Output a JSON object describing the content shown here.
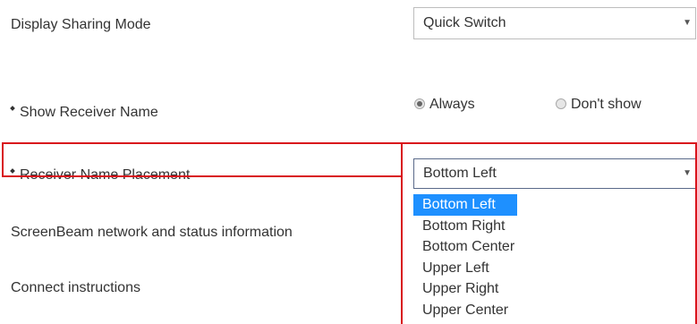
{
  "settings": {
    "display_sharing_mode": {
      "label": "Display Sharing Mode",
      "value": "Quick Switch"
    },
    "show_receiver_name": {
      "label": "Show Receiver Name",
      "options": [
        "Always",
        "Don't show"
      ],
      "selected": "Always"
    },
    "receiver_name_placement": {
      "label": "Receiver Name Placement",
      "value": "Bottom Left",
      "options": [
        "Bottom Left",
        "Bottom Right",
        "Bottom Center",
        "Upper Left",
        "Upper Right",
        "Upper Center"
      ]
    },
    "network_info": {
      "label": "ScreenBeam network and status information"
    },
    "connect_instructions": {
      "label": "Connect instructions"
    }
  },
  "icons": {
    "select_caret": "caret-down-icon"
  },
  "colors": {
    "highlight": "#d9141c",
    "dropdown_selected": "#1e90ff"
  }
}
